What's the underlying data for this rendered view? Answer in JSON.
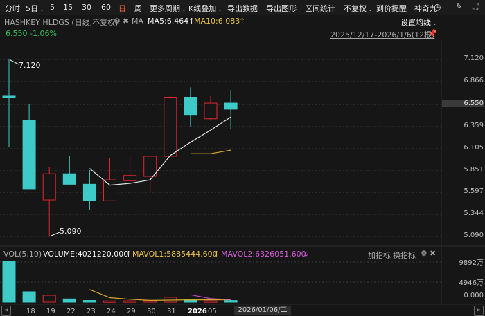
{
  "toolbar": {
    "items": [
      {
        "label": "分时"
      },
      {
        "label": "5日",
        "dropdown": true
      },
      {
        "label": "5"
      },
      {
        "label": "15"
      },
      {
        "label": "30"
      },
      {
        "label": "60"
      },
      {
        "label": "日",
        "active": true
      },
      {
        "label": "周"
      },
      {
        "label": "更多周期",
        "dropdown": true
      },
      {
        "label": "K线叠加",
        "dropdown": true
      },
      {
        "label": "导出数据"
      },
      {
        "label": "导出图形"
      },
      {
        "label": "区间统计"
      },
      {
        "label": "不复权",
        "dropdown": true
      },
      {
        "label": "到价提醒"
      },
      {
        "label": "神奇九"
      }
    ]
  },
  "header": {
    "title": "HASHKEY HLDGS (日线,不复权)",
    "ma_label": "MA",
    "ma5": "MA5:6.464",
    "ma5_arrow": "↑",
    "ma10": "MA10:6.083",
    "ma10_arrow": "↑",
    "set_ma": "设置均线",
    "price_change": "6.550  -1.06%",
    "range": "2025/12/17-2026/1/6(12根)"
  },
  "colors": {
    "up": "#e0262f",
    "down": "#3ecbc8",
    "ma5": "#e6e6e6",
    "ma10": "#d4a82a",
    "mavol2": "#c44fc8",
    "accent": "#f0622d"
  },
  "price_axis": {
    "labels": [
      "7.120",
      "6.866",
      "6.550",
      "6.359",
      "6.105",
      "5.851",
      "5.597",
      "5.344",
      "5.090"
    ],
    "current": "6.550"
  },
  "annotations": {
    "high": "7.120",
    "low": "5.090"
  },
  "volume": {
    "label": "VOL(5,10)",
    "volume": "VOLUME:4021220.000",
    "vol_arrow": "↑",
    "mavol1": "MAVOL1:5885444.600",
    "mavol1_arrow": "↑",
    "mavol2": "MAVOL2:6326051.600",
    "mavol2_arrow": "↓",
    "add_indicator": "加指标",
    "switch_indicator": "换指标",
    "axis": [
      "9892万",
      "4946万",
      "0.000"
    ]
  },
  "x_axis": {
    "labels": [
      "18",
      "19",
      "22",
      "23",
      "24",
      "29",
      "30",
      "31",
      "2026",
      "05"
    ],
    "cursor_date": "2026/01/06/二"
  },
  "chart_data": {
    "type": "candlestick",
    "ylim": [
      5.09,
      7.12
    ],
    "candles": [
      {
        "o": 6.7,
        "h": 7.12,
        "l": 6.12,
        "c": 6.68,
        "v": 10000
      },
      {
        "o": 6.42,
        "h": 6.61,
        "l": 5.63,
        "c": 5.63,
        "v": 2560
      },
      {
        "o": 5.51,
        "h": 5.89,
        "l": 5.09,
        "c": 5.81,
        "v": 1700
      },
      {
        "o": 5.81,
        "h": 6.01,
        "l": 5.69,
        "c": 5.69,
        "v": 800
      },
      {
        "o": 5.69,
        "h": 5.85,
        "l": 5.4,
        "c": 5.5,
        "v": 420
      },
      {
        "o": 5.5,
        "h": 5.99,
        "l": 5.5,
        "c": 5.74,
        "v": 300
      },
      {
        "o": 5.73,
        "h": 6.02,
        "l": 5.71,
        "c": 5.79,
        "v": 320
      },
      {
        "o": 5.78,
        "h": 6.01,
        "l": 5.61,
        "c": 6.01,
        "v": 420
      },
      {
        "o": 6.01,
        "h": 6.7,
        "l": 6.01,
        "c": 6.68,
        "v": 1200
      },
      {
        "o": 6.68,
        "h": 6.8,
        "l": 6.35,
        "c": 6.48,
        "v": 600
      },
      {
        "o": 6.44,
        "h": 6.7,
        "l": 6.42,
        "c": 6.62,
        "v": 320
      },
      {
        "o": 6.62,
        "h": 6.77,
        "l": 6.32,
        "c": 6.55,
        "v": 402
      }
    ],
    "ma5": [
      null,
      null,
      null,
      null,
      5.87,
      5.68,
      5.7,
      5.74,
      6.02,
      6.17,
      6.31,
      6.46
    ],
    "ma10": [
      null,
      null,
      null,
      null,
      null,
      null,
      null,
      null,
      null,
      6.04,
      6.04,
      6.08
    ],
    "mavol1": [
      null,
      null,
      null,
      null,
      3100,
      1110,
      710,
      450,
      510,
      570,
      570,
      590
    ],
    "mavol2": [
      null,
      null,
      null,
      null,
      null,
      null,
      null,
      null,
      null,
      1840,
      880,
      630
    ]
  }
}
